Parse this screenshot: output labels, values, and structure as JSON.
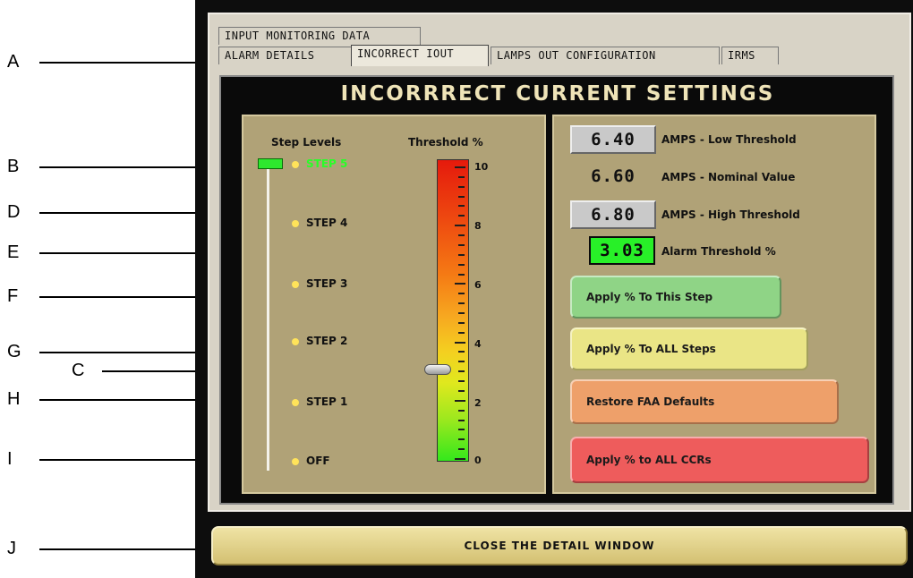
{
  "callouts": [
    "A",
    "B",
    "C",
    "D",
    "E",
    "F",
    "G",
    "H",
    "I",
    "J"
  ],
  "tabs": {
    "row1": [
      "INPUT MONITORING DATA"
    ],
    "row2": [
      "ALARM DETAILS",
      "INCORRECT IOUT",
      "LAMPS OUT CONFIGURATION",
      "IRMS"
    ]
  },
  "panel": {
    "title": "INCORRRECT CURRENT SETTINGS"
  },
  "steps": {
    "header_steps": "Step Levels",
    "header_threshold": "Threshold %",
    "levels": [
      "STEP 5",
      "STEP 4",
      "STEP 3",
      "STEP 2",
      "STEP 1",
      "OFF"
    ],
    "current": "STEP 5"
  },
  "gauge": {
    "ticks": [
      "10",
      "8",
      "6",
      "4",
      "2",
      "0"
    ],
    "min": 0,
    "max": 10,
    "slider_value": 3.03
  },
  "values": {
    "low": {
      "value": "6.40",
      "label": "AMPS - Low Threshold"
    },
    "nominal": {
      "value": "6.60",
      "label": "AMPS - Nominal Value"
    },
    "high": {
      "value": "6.80",
      "label": "AMPS - High Threshold"
    },
    "alarm": {
      "value": "3.03",
      "label": "Alarm Threshold %"
    }
  },
  "buttons": {
    "apply_step": "Apply % To This Step",
    "apply_all_steps": "Apply % To ALL Steps",
    "restore_defaults": "Restore FAA Defaults",
    "apply_all_ccrs": "Apply % to ALL CCRs",
    "close": "CLOSE THE DETAIL WINDOW"
  },
  "colors": {
    "apply_step": "#8fd486",
    "apply_all_steps": "#eae586",
    "restore_defaults": "#eea06a",
    "apply_all_ccrs": "#ee5c5c",
    "panel_bg": "#b0a277",
    "current_step": "#28ff28"
  }
}
